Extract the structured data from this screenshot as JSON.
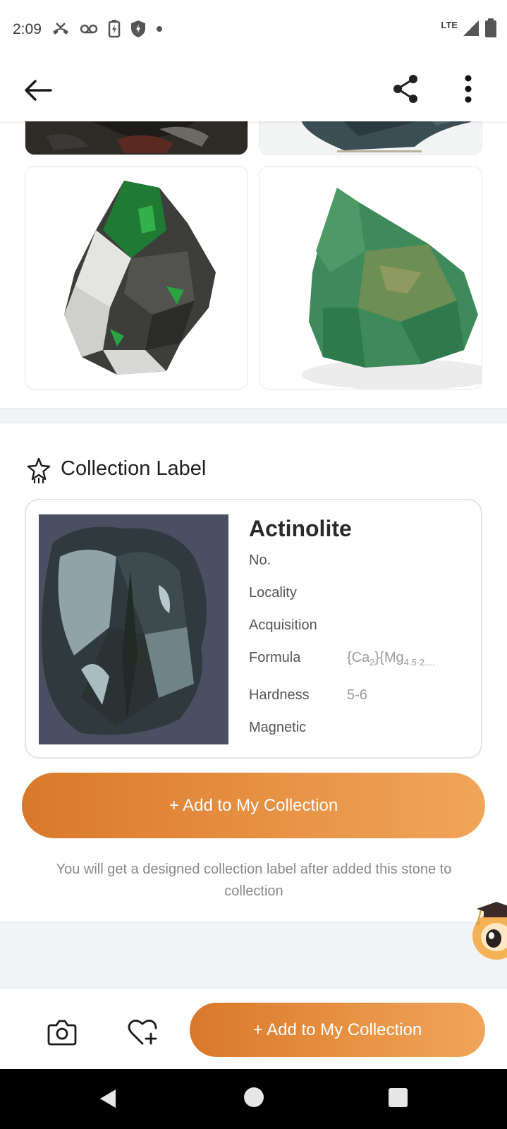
{
  "status_bar": {
    "time": "2:09",
    "network": "LTE",
    "icons": [
      "missed-call-icon",
      "voicemail-icon",
      "battery-saver-icon",
      "shield-icon",
      "dot-icon",
      "signal-icon",
      "battery-icon"
    ]
  },
  "toolbar": {
    "icons": [
      "back-arrow-icon",
      "share-icon",
      "more-vert-icon"
    ]
  },
  "gallery": {
    "images": [
      "dark-rock-photo",
      "dark-green-mineral-photo",
      "green-white-mineral-photo",
      "green-rock-photo"
    ]
  },
  "collection_label": {
    "section_title": "Collection Label",
    "name": "Actinolite",
    "fields": {
      "no_label": "No.",
      "locality_label": "Locality",
      "acquisition_label": "Acquisition",
      "formula_label": "Formula",
      "formula_ca": "{Ca",
      "formula_ca_sub": "2",
      "formula_mg": "}{Mg",
      "formula_mg_sub": "4.5-2....",
      "hardness_label": "Hardness",
      "hardness_value": "5-6",
      "magnetic_label": "Magnetic"
    }
  },
  "cta": {
    "add_button_label": "+ Add to My Collection",
    "hint_text": "You will get a designed collection label after added this stone to collection"
  },
  "bottom_bar": {
    "add_button_label": "+ Add to My Collection",
    "icons": [
      "camera-icon",
      "heart-plus-icon"
    ]
  },
  "colors": {
    "accent_orange": "#e2873a",
    "band_gray": "#f1f4f7"
  }
}
